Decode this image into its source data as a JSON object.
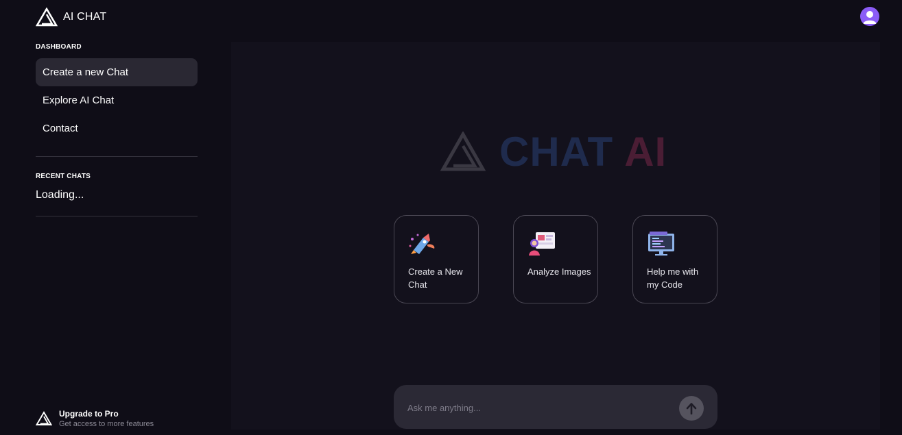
{
  "header": {
    "brand_text": "AI CHAT",
    "logo_icon": "triangle-logo-icon",
    "avatar_icon": "user-avatar-icon"
  },
  "sidebar": {
    "dashboard_label": "DASHBOARD",
    "nav_items": [
      {
        "label": "Create a new Chat",
        "active": true
      },
      {
        "label": "Explore AI Chat",
        "active": false
      },
      {
        "label": "Contact",
        "active": false
      }
    ],
    "recent_chats_label": "RECENT CHATS",
    "recent_chats_status": "Loading...",
    "upgrade": {
      "title": "Upgrade to Pro",
      "subtitle": "Get access to more features"
    }
  },
  "main": {
    "hero": {
      "word1": "CHAT",
      "word2": "AI"
    },
    "cards": [
      {
        "label": "Create a New Chat",
        "icon": "rocket-illustration-icon"
      },
      {
        "label": "Analyze Images",
        "icon": "image-analysis-illustration-icon"
      },
      {
        "label": "Help me with my Code",
        "icon": "code-monitor-illustration-icon"
      }
    ],
    "composer": {
      "placeholder": "Ask me anything...",
      "value": "",
      "send_icon": "arrow-up-icon"
    }
  },
  "colors": {
    "background": "#0f0d17",
    "panel": "#13111c",
    "active_nav": "#2a2833",
    "avatar": "#8b5cf6",
    "hero_chat": "#1f2b4d",
    "hero_ai": "#4a1d34"
  }
}
